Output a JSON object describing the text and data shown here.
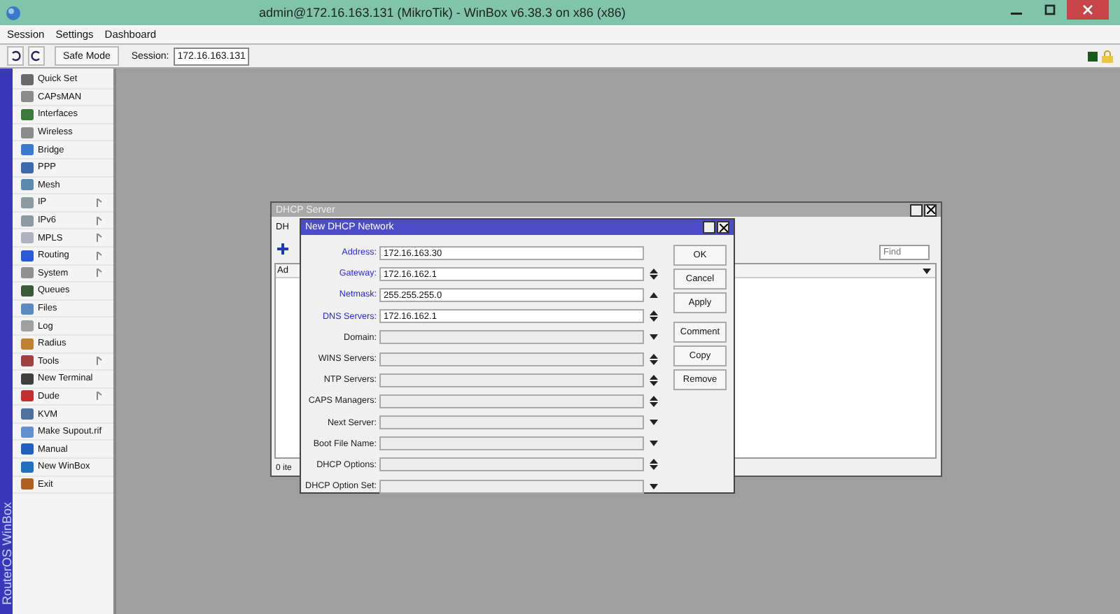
{
  "window": {
    "title": "admin@172.16.163.131 (MikroTik) - WinBox v6.38.3 on x86 (x86)"
  },
  "menu": [
    "Session",
    "Settings",
    "Dashboard"
  ],
  "toolbar": {
    "safe_mode": "Safe Mode",
    "session_label": "Session:",
    "session_value": "172.16.163.131"
  },
  "brand": "RouterOS WinBox",
  "sidebar": {
    "items": [
      {
        "label": "Quick Set",
        "submenu": false
      },
      {
        "label": "CAPsMAN",
        "submenu": false
      },
      {
        "label": "Interfaces",
        "submenu": false
      },
      {
        "label": "Wireless",
        "submenu": false
      },
      {
        "label": "Bridge",
        "submenu": false
      },
      {
        "label": "PPP",
        "submenu": false
      },
      {
        "label": "Mesh",
        "submenu": false
      },
      {
        "label": "IP",
        "submenu": true
      },
      {
        "label": "IPv6",
        "submenu": true
      },
      {
        "label": "MPLS",
        "submenu": true
      },
      {
        "label": "Routing",
        "submenu": true
      },
      {
        "label": "System",
        "submenu": true
      },
      {
        "label": "Queues",
        "submenu": false
      },
      {
        "label": "Files",
        "submenu": false
      },
      {
        "label": "Log",
        "submenu": false
      },
      {
        "label": "Radius",
        "submenu": false
      },
      {
        "label": "Tools",
        "submenu": true
      },
      {
        "label": "New Terminal",
        "submenu": false
      },
      {
        "label": "Dude",
        "submenu": true
      },
      {
        "label": "KVM",
        "submenu": false
      },
      {
        "label": "Make Supout.rif",
        "submenu": false
      },
      {
        "label": "Manual",
        "submenu": false
      },
      {
        "label": "New WinBox",
        "submenu": false
      },
      {
        "label": "Exit",
        "submenu": false
      }
    ]
  },
  "dhcp_server": {
    "title": "DHCP Server",
    "tab": "DH",
    "column": "Ad",
    "find": {
      "placeholder": "Find"
    },
    "status": "0 ite"
  },
  "dialog": {
    "title": "New DHCP Network",
    "fields": [
      {
        "label": "Address:",
        "value": "172.16.163.30",
        "set": true,
        "kind": "none"
      },
      {
        "label": "Gateway:",
        "value": "172.16.162.1",
        "set": true,
        "kind": "updown"
      },
      {
        "label": "Netmask:",
        "value": "255.255.255.0",
        "set": true,
        "kind": "up"
      },
      {
        "label": "DNS Servers:",
        "value": "172.16.162.1",
        "set": true,
        "kind": "updown"
      },
      {
        "label": "Domain:",
        "set": false,
        "kind": "down"
      },
      {
        "label": "WINS Servers:",
        "set": false,
        "kind": "updown"
      },
      {
        "label": "NTP Servers:",
        "set": false,
        "kind": "updown"
      },
      {
        "label": "CAPS Managers:",
        "set": false,
        "kind": "updown"
      },
      {
        "label": "Next Server:",
        "set": false,
        "kind": "down"
      },
      {
        "label": "Boot File Name:",
        "set": false,
        "kind": "down"
      },
      {
        "label": "DHCP Options:",
        "set": false,
        "kind": "updown"
      },
      {
        "label": "DHCP Option Set:",
        "set": false,
        "kind": "down"
      }
    ],
    "buttons": [
      [
        "OK",
        "Cancel",
        "Apply"
      ],
      [
        "Comment",
        "Copy",
        "Remove"
      ]
    ]
  }
}
